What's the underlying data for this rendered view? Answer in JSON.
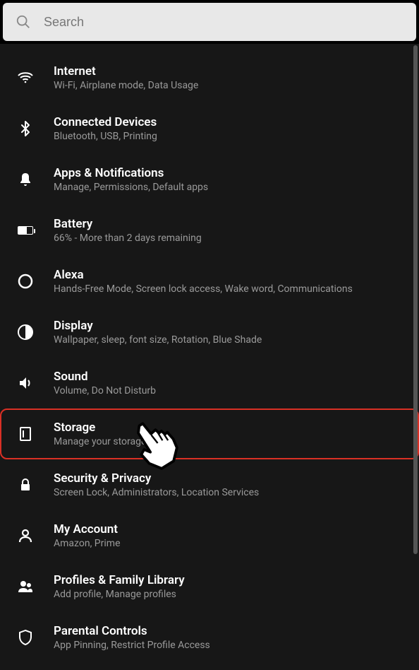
{
  "search": {
    "placeholder": "Search"
  },
  "items": [
    {
      "title": "Internet",
      "subtitle": "Wi-Fi, Airplane mode, Data Usage"
    },
    {
      "title": "Connected Devices",
      "subtitle": "Bluetooth, USB, Printing"
    },
    {
      "title": "Apps & Notifications",
      "subtitle": "Manage, Permissions, Default apps"
    },
    {
      "title": "Battery",
      "subtitle": "66% - More than 2 days remaining"
    },
    {
      "title": "Alexa",
      "subtitle": "Hands-Free Mode, Screen lock access, Wake word, Communications"
    },
    {
      "title": "Display",
      "subtitle": "Wallpaper, sleep, font size, Rotation, Blue Shade"
    },
    {
      "title": "Sound",
      "subtitle": "Volume, Do Not Disturb"
    },
    {
      "title": "Storage",
      "subtitle": "Manage your storage"
    },
    {
      "title": "Security & Privacy",
      "subtitle": "Screen Lock, Administrators, Location Services"
    },
    {
      "title": "My Account",
      "subtitle": "Amazon, Prime"
    },
    {
      "title": "Profiles & Family Library",
      "subtitle": "Add profile, Manage profiles"
    },
    {
      "title": "Parental Controls",
      "subtitle": "App Pinning, Restrict Profile Access"
    }
  ],
  "highlight_index": 7
}
